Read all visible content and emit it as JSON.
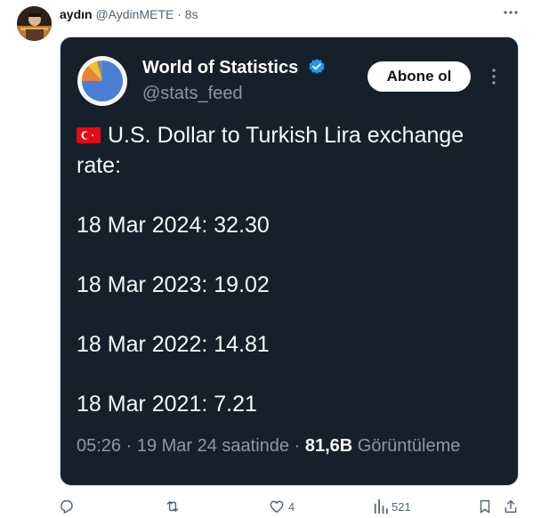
{
  "tweet": {
    "author_name": "aydın",
    "author_handle": "@AydinMETE",
    "separator": "·",
    "time": "8s"
  },
  "quoted": {
    "name": "World of Statistics",
    "handle": "@stats_feed",
    "follow_label": "Abone ol",
    "title": "U.S. Dollar to Turkish Lira exchange rate:",
    "lines": [
      "18 Mar 2024: 32.30",
      "18 Mar 2023: 19.02",
      "18 Mar 2022: 14.81",
      "18 Mar 2021: 7.21"
    ],
    "meta_time": "05:26 · 19 Mar 24 saatinde ·",
    "views_count": "81,6B",
    "views_label": "Görüntüleme"
  },
  "actions": {
    "likes": "4",
    "views": "521"
  },
  "colors": {
    "card_bg": "#15202b",
    "verified": "#1d9bf0",
    "flag_red": "#e30a17"
  }
}
